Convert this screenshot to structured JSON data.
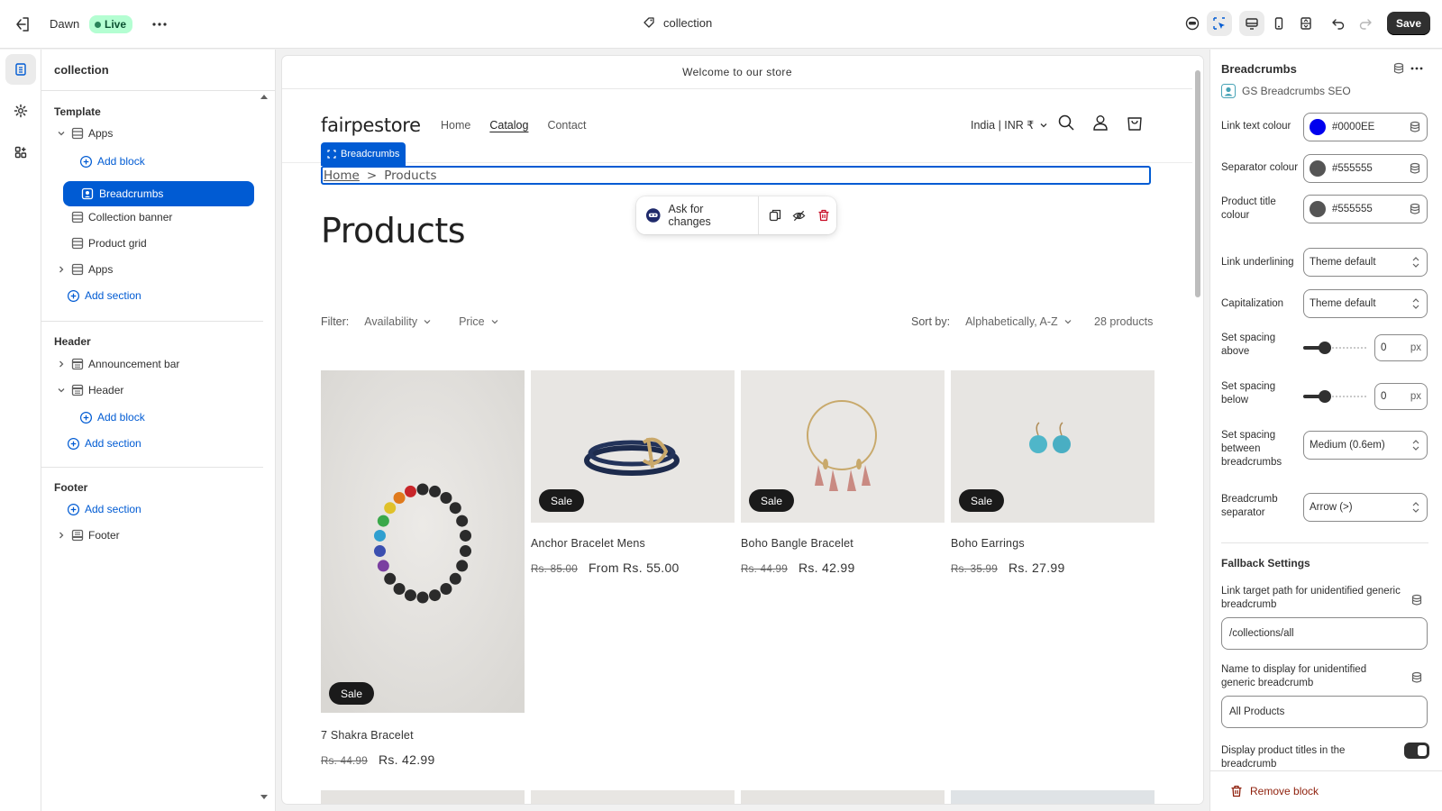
{
  "topbar": {
    "theme_name": "Dawn",
    "live_badge": "Live",
    "template_name": "collection",
    "save_label": "Save"
  },
  "left_panel": {
    "title": "collection",
    "template_heading": "Template",
    "header_heading": "Header",
    "footer_heading": "Footer",
    "template_items": {
      "apps": "Apps",
      "add_block": "Add block",
      "breadcrumbs": "Breadcrumbs",
      "collection_banner": "Collection banner",
      "product_grid": "Product grid",
      "apps2": "Apps",
      "add_section": "Add section"
    },
    "header_items": {
      "announcement_bar": "Announcement bar",
      "header": "Header",
      "add_block": "Add block",
      "add_section": "Add section"
    },
    "footer_items": {
      "add_section": "Add section",
      "footer": "Footer"
    }
  },
  "preview": {
    "announcement": "Welcome to our store",
    "logo": "fairpestore",
    "nav": [
      "Home",
      "Catalog",
      "Contact"
    ],
    "locale": "India | INR ₹",
    "breadcrumbs_tag": "Breadcrumbs",
    "breadcrumb_home": "Home",
    "breadcrumb_sep": ">",
    "breadcrumb_current": "Products",
    "ai_ask": "Ask for changes",
    "heading": "Products",
    "filter_label": "Filter:",
    "filter_availability": "Availability",
    "filter_price": "Price",
    "sort_label": "Sort by:",
    "sort_value": "Alphabetically, A-Z",
    "product_count": "28 products",
    "sale_badge": "Sale",
    "products": [
      {
        "name": "7 Shakra Bracelet",
        "old_price": "Rs. 44.99",
        "price": "Rs. 42.99"
      },
      {
        "name": "Anchor Bracelet Mens",
        "old_price": "Rs. 85.00",
        "price": "From Rs. 55.00"
      },
      {
        "name": "Boho Bangle Bracelet",
        "old_price": "Rs. 44.99",
        "price": "Rs. 42.99"
      },
      {
        "name": "Boho Earrings",
        "old_price": "Rs. 35.99",
        "price": "Rs. 27.99"
      }
    ]
  },
  "right_panel": {
    "title": "Breadcrumbs",
    "app_name": "GS Breadcrumbs SEO",
    "link_text_colour_label": "Link text colour",
    "link_text_colour": "#0000EE",
    "separator_colour_label": "Separator colour",
    "separator_colour": "#555555",
    "product_title_colour_label": "Product title colour",
    "product_title_colour": "#555555",
    "link_underlining_label": "Link underlining",
    "link_underlining": "Theme default",
    "capitalization_label": "Capitalization",
    "capitalization": "Theme default",
    "spacing_above_label": "Set spacing above",
    "spacing_above": "0",
    "spacing_below_label": "Set spacing below",
    "spacing_below": "0",
    "px_unit": "px",
    "spacing_between_label": "Set spacing between breadcrumbs",
    "spacing_between": "Medium (0.6em)",
    "separator_label": "Breadcrumb separator",
    "separator": "Arrow (>)",
    "fallback_heading": "Fallback Settings",
    "link_target_label": "Link target path for unidentified generic breadcrumb",
    "link_target": "/collections/all",
    "display_name_label": "Name to display for unidentified generic breadcrumb",
    "display_name": "All Products",
    "display_titles_label": "Display product titles in the breadcrumb",
    "remove_block": "Remove block"
  },
  "colors": {
    "accent": "#005bd3",
    "link_swatch": "#0000EE",
    "separator_swatch": "#555555",
    "product_title_swatch": "#555555",
    "danger": "#8e1f0b"
  }
}
